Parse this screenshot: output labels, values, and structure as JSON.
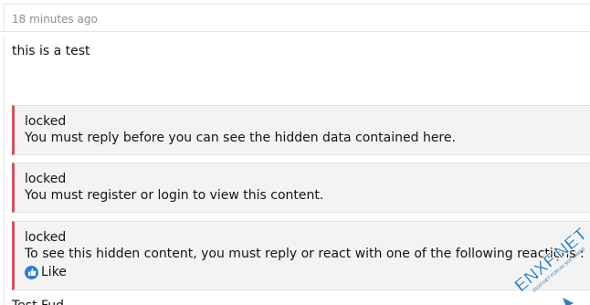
{
  "post": {
    "timestamp": "18 minutes ago",
    "message": "this is a test"
  },
  "locked_blocks": [
    {
      "title": "locked",
      "message": "You must reply before you can see the hidden data contained here."
    },
    {
      "title": "locked",
      "message": "You must register or login to view this content."
    },
    {
      "title": "locked",
      "message": "To see this hidden content, you must reply or react with one of the following reactions :",
      "reaction": {
        "icon": "thumbs-up-icon",
        "label": "Like"
      }
    }
  ],
  "next_text": "Test Fud",
  "watermark": {
    "text": "ENXF.NET",
    "subtext": "ENXF.NET FORUM SOFTWARE"
  },
  "colors": {
    "locked_border": "#d94f5c",
    "locked_bg": "#f3f3f3",
    "like_icon": "#2d7dd2",
    "timestamp": "#8c8c8c",
    "watermark": "#2d7fc2"
  }
}
